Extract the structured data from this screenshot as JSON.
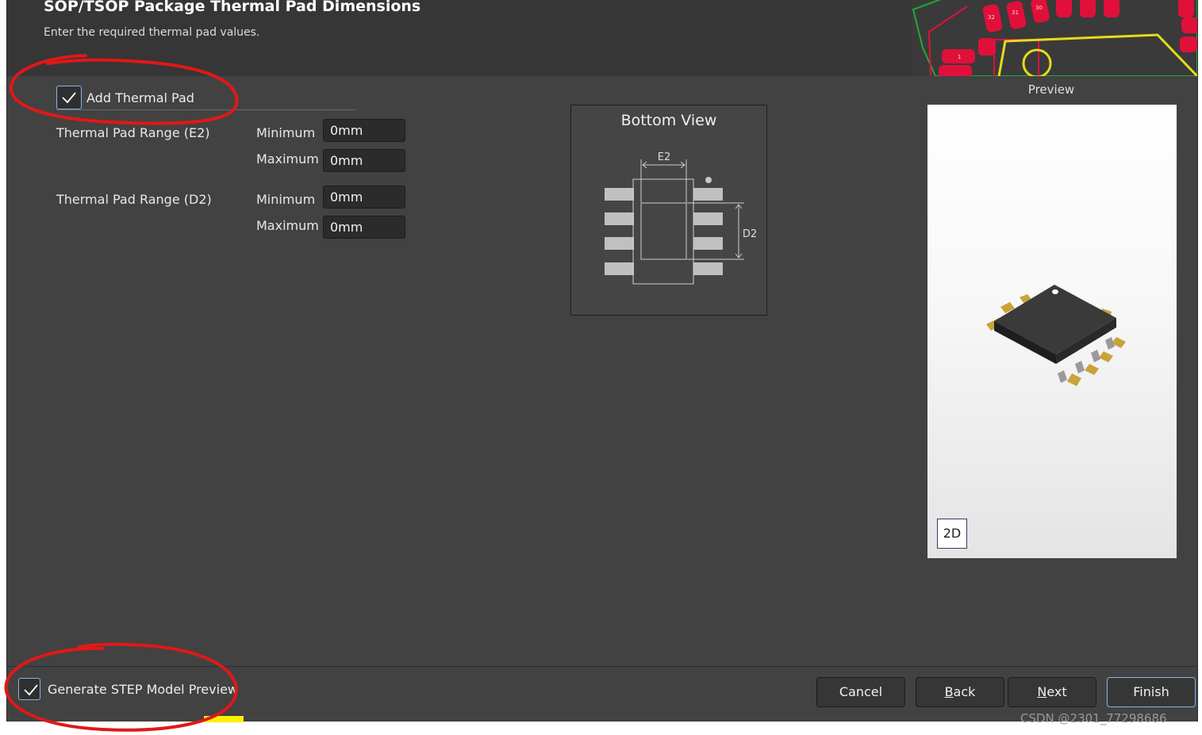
{
  "header": {
    "title": "SOP/TSOP Package Thermal Pad Dimensions",
    "subtitle": "Enter the required thermal pad values."
  },
  "thermal": {
    "checkbox_label": "Add Thermal Pad",
    "checked": true,
    "e2": {
      "label": "Thermal Pad Range (E2)",
      "min_label": "Minimum",
      "min_value": "0mm",
      "max_label": "Maximum",
      "max_value": "0mm"
    },
    "d2": {
      "label": "Thermal Pad Range (D2)",
      "min_label": "Minimum",
      "min_value": "0mm",
      "max_label": "Maximum",
      "max_value": "0mm"
    }
  },
  "bottom_view": {
    "title": "Bottom View",
    "dim_e2": "E2",
    "dim_d2": "D2"
  },
  "preview": {
    "label": "Preview",
    "toggle_2d": "2D"
  },
  "footer": {
    "step_label": "Generate STEP Model Preview",
    "step_checked": true,
    "buttons": {
      "cancel": "Cancel",
      "back_mnemonic": "B",
      "back_rest": "ack",
      "next_mnemonic": "N",
      "next_rest": "ext",
      "finish": "Finish"
    }
  },
  "pcb_art": {
    "pin_labels": [
      "32",
      "31",
      "30",
      "1"
    ]
  },
  "watermark": "CSDN @2301_77298686",
  "colors": {
    "window_bg": "#424242",
    "header_bg": "#363636",
    "accent_border": "#8ab4e8",
    "annotation_red": "#e01818",
    "pad_red": "#e0103a",
    "pin_gold": "#c9a23a"
  }
}
